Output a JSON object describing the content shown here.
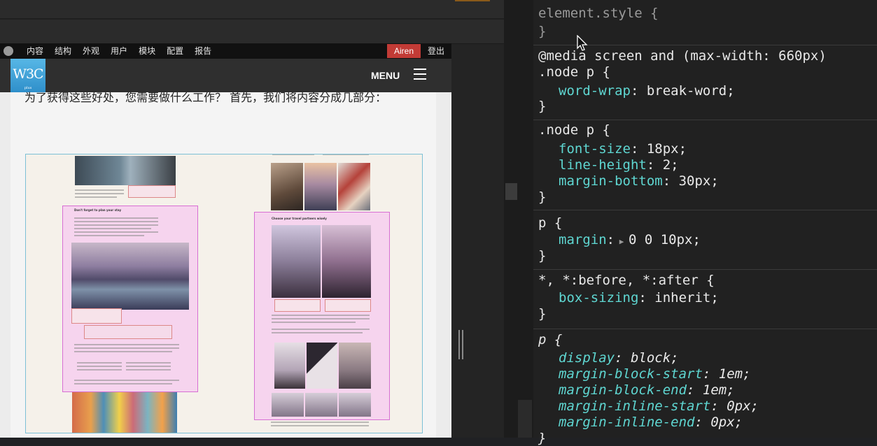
{
  "admin_bar": {
    "menu": [
      "内容",
      "结构",
      "外观",
      "用户",
      "模块",
      "配置",
      "报告"
    ],
    "user": "Airen",
    "logout": "登出"
  },
  "site_header": {
    "logo_text": "W3C",
    "logo_small": "plus",
    "menu_label": "MENU"
  },
  "article": {
    "paragraph": "为了获得这些好处，您需要做什么工作？ 首先，我们将内容分成几部分："
  },
  "figure": {
    "left_heading": "Don't forget to plan your stay",
    "right_heading": "Choose your travel partners wisely"
  },
  "devtools": {
    "rules": [
      {
        "selector": "element.style {",
        "close": "}"
      },
      {
        "media": "@media screen and (max-width: 660px)",
        "selector": ".node p {",
        "props": [
          {
            "name": "word-wrap",
            "value": "break-word;"
          }
        ],
        "close": "}"
      },
      {
        "selector": ".node p {",
        "props": [
          {
            "name": "font-size",
            "value": "18px;"
          },
          {
            "name": "line-height",
            "value": "2;"
          },
          {
            "name": "margin-bottom",
            "value": "30px;"
          }
        ],
        "close": "}"
      },
      {
        "selector": "p {",
        "props": [
          {
            "name": "margin",
            "value": "0 0 10px;"
          }
        ],
        "close": "}"
      },
      {
        "selector": "*, *:before, *:after {",
        "props": [
          {
            "name": "box-sizing",
            "value": "inherit;"
          }
        ],
        "close": "}"
      },
      {
        "selector": "p {",
        "props": [
          {
            "name": "display",
            "value": "block;"
          },
          {
            "name": "margin-block-start",
            "value": "1em;"
          },
          {
            "name": "margin-block-end",
            "value": "1em;"
          },
          {
            "name": "margin-inline-start",
            "value": "0px;"
          },
          {
            "name": "margin-inline-end",
            "value": "0px;"
          }
        ],
        "close": "}"
      }
    ]
  },
  "colors": {
    "prop": "#5fd7d2",
    "user_badge": "#c23b36",
    "logo": "#3aa2d8"
  }
}
